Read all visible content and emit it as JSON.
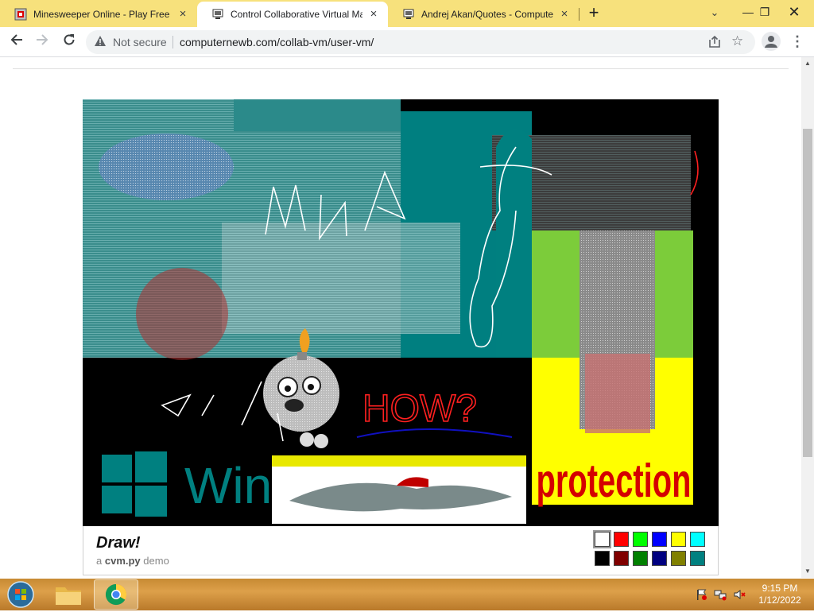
{
  "browser": {
    "tabs": [
      {
        "title": "Minesweeper Online - Play Free O",
        "active": false,
        "icon": "minesweeper-favicon"
      },
      {
        "title": "Control Collaborative Virtual Mac",
        "active": true,
        "icon": "computernewb-favicon"
      },
      {
        "title": "Andrej Akan/Quotes - Computern",
        "active": false,
        "icon": "computernewb-favicon"
      }
    ],
    "new_tab_label": "+",
    "security_label": "Not secure",
    "url": "computernewb.com/collab-vm/user-vm/"
  },
  "vm_screen": {
    "scribbles": [
      "HOW?",
      "WHA"
    ],
    "protection_text": "protection",
    "windows_logo_text": "Win",
    "colors": {
      "teal": "#008080",
      "yellow": "#ffff00",
      "red": "#d40000"
    }
  },
  "draw_panel": {
    "title": "Draw!",
    "subtitle_prefix": "a",
    "subtitle_bold": "cvm.py",
    "subtitle_suffix": "demo",
    "palette": [
      {
        "name": "white",
        "hex": "#ffffff",
        "selected": true
      },
      {
        "name": "red",
        "hex": "#ff0000"
      },
      {
        "name": "lime",
        "hex": "#00ff00"
      },
      {
        "name": "blue",
        "hex": "#0000ff"
      },
      {
        "name": "yellow",
        "hex": "#ffff00"
      },
      {
        "name": "cyan",
        "hex": "#00ffff"
      },
      {
        "name": "black",
        "hex": "#000000"
      },
      {
        "name": "maroon",
        "hex": "#800000"
      },
      {
        "name": "green",
        "hex": "#008000"
      },
      {
        "name": "navy",
        "hex": "#000080"
      },
      {
        "name": "olive",
        "hex": "#808000"
      },
      {
        "name": "teal",
        "hex": "#008080"
      }
    ]
  },
  "taskbar": {
    "apps": [
      "file-explorer",
      "chrome"
    ],
    "time": "9:15 PM",
    "date": "1/12/2022"
  }
}
